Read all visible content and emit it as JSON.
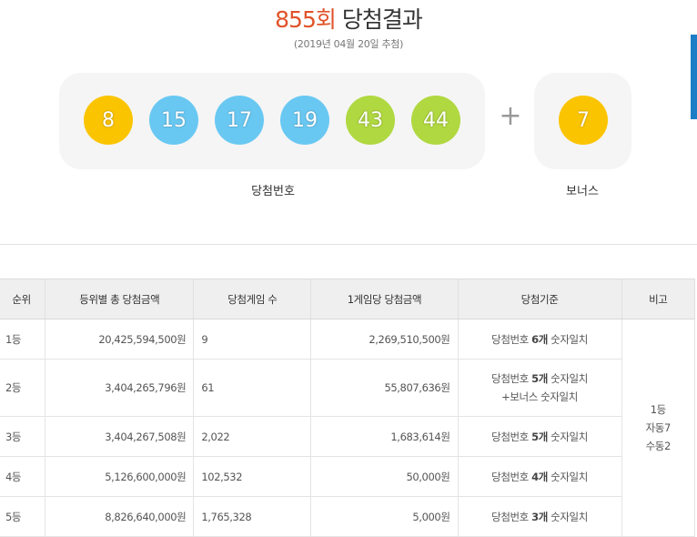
{
  "header": {
    "round": "855회",
    "title": "당첨결과",
    "draw_date": "(2019년 04월 20일 추첨)"
  },
  "numbers": {
    "winning": [
      {
        "value": "8",
        "color": "#fbc400"
      },
      {
        "value": "15",
        "color": "#69c8f2"
      },
      {
        "value": "17",
        "color": "#69c8f2"
      },
      {
        "value": "19",
        "color": "#69c8f2"
      },
      {
        "value": "43",
        "color": "#b0d840"
      },
      {
        "value": "44",
        "color": "#b0d840"
      }
    ],
    "plus": "+",
    "bonus": {
      "value": "7",
      "color": "#fbc400"
    },
    "winning_label": "당첨번호",
    "bonus_label": "보너스"
  },
  "table": {
    "headers": [
      "순위",
      "등위별 총 당첨금액",
      "당첨게임 수",
      "1게임당 당첨금액",
      "당첨기준",
      "비고"
    ],
    "rows": [
      {
        "rank": "1등",
        "total": "20,425,594,500원",
        "count": "9",
        "per_game": "2,269,510,500원",
        "criteria_pre": "당첨번호 ",
        "criteria_bold": "6개",
        "criteria_post": " 숫자일치",
        "criteria_line2": ""
      },
      {
        "rank": "2등",
        "total": "3,404,265,796원",
        "count": "61",
        "per_game": "55,807,636원",
        "criteria_pre": "당첨번호 ",
        "criteria_bold": "5개",
        "criteria_post": " 숫자일치",
        "criteria_line2": "+보너스 숫자일치"
      },
      {
        "rank": "3등",
        "total": "3,404,267,508원",
        "count": "2,022",
        "per_game": "1,683,614원",
        "criteria_pre": "당첨번호 ",
        "criteria_bold": "5개",
        "criteria_post": " 숫자일치",
        "criteria_line2": ""
      },
      {
        "rank": "4등",
        "total": "5,126,600,000원",
        "count": "102,532",
        "per_game": "50,000원",
        "criteria_pre": "당첨번호 ",
        "criteria_bold": "4개",
        "criteria_post": " 숫자일치",
        "criteria_line2": ""
      },
      {
        "rank": "5등",
        "total": "8,826,640,000원",
        "count": "1,765,328",
        "per_game": "5,000원",
        "criteria_pre": "당첨번호 ",
        "criteria_bold": "3개",
        "criteria_post": " 숫자일치",
        "criteria_line2": ""
      }
    ],
    "note": [
      "1등",
      "자동7",
      "수동2"
    ]
  }
}
